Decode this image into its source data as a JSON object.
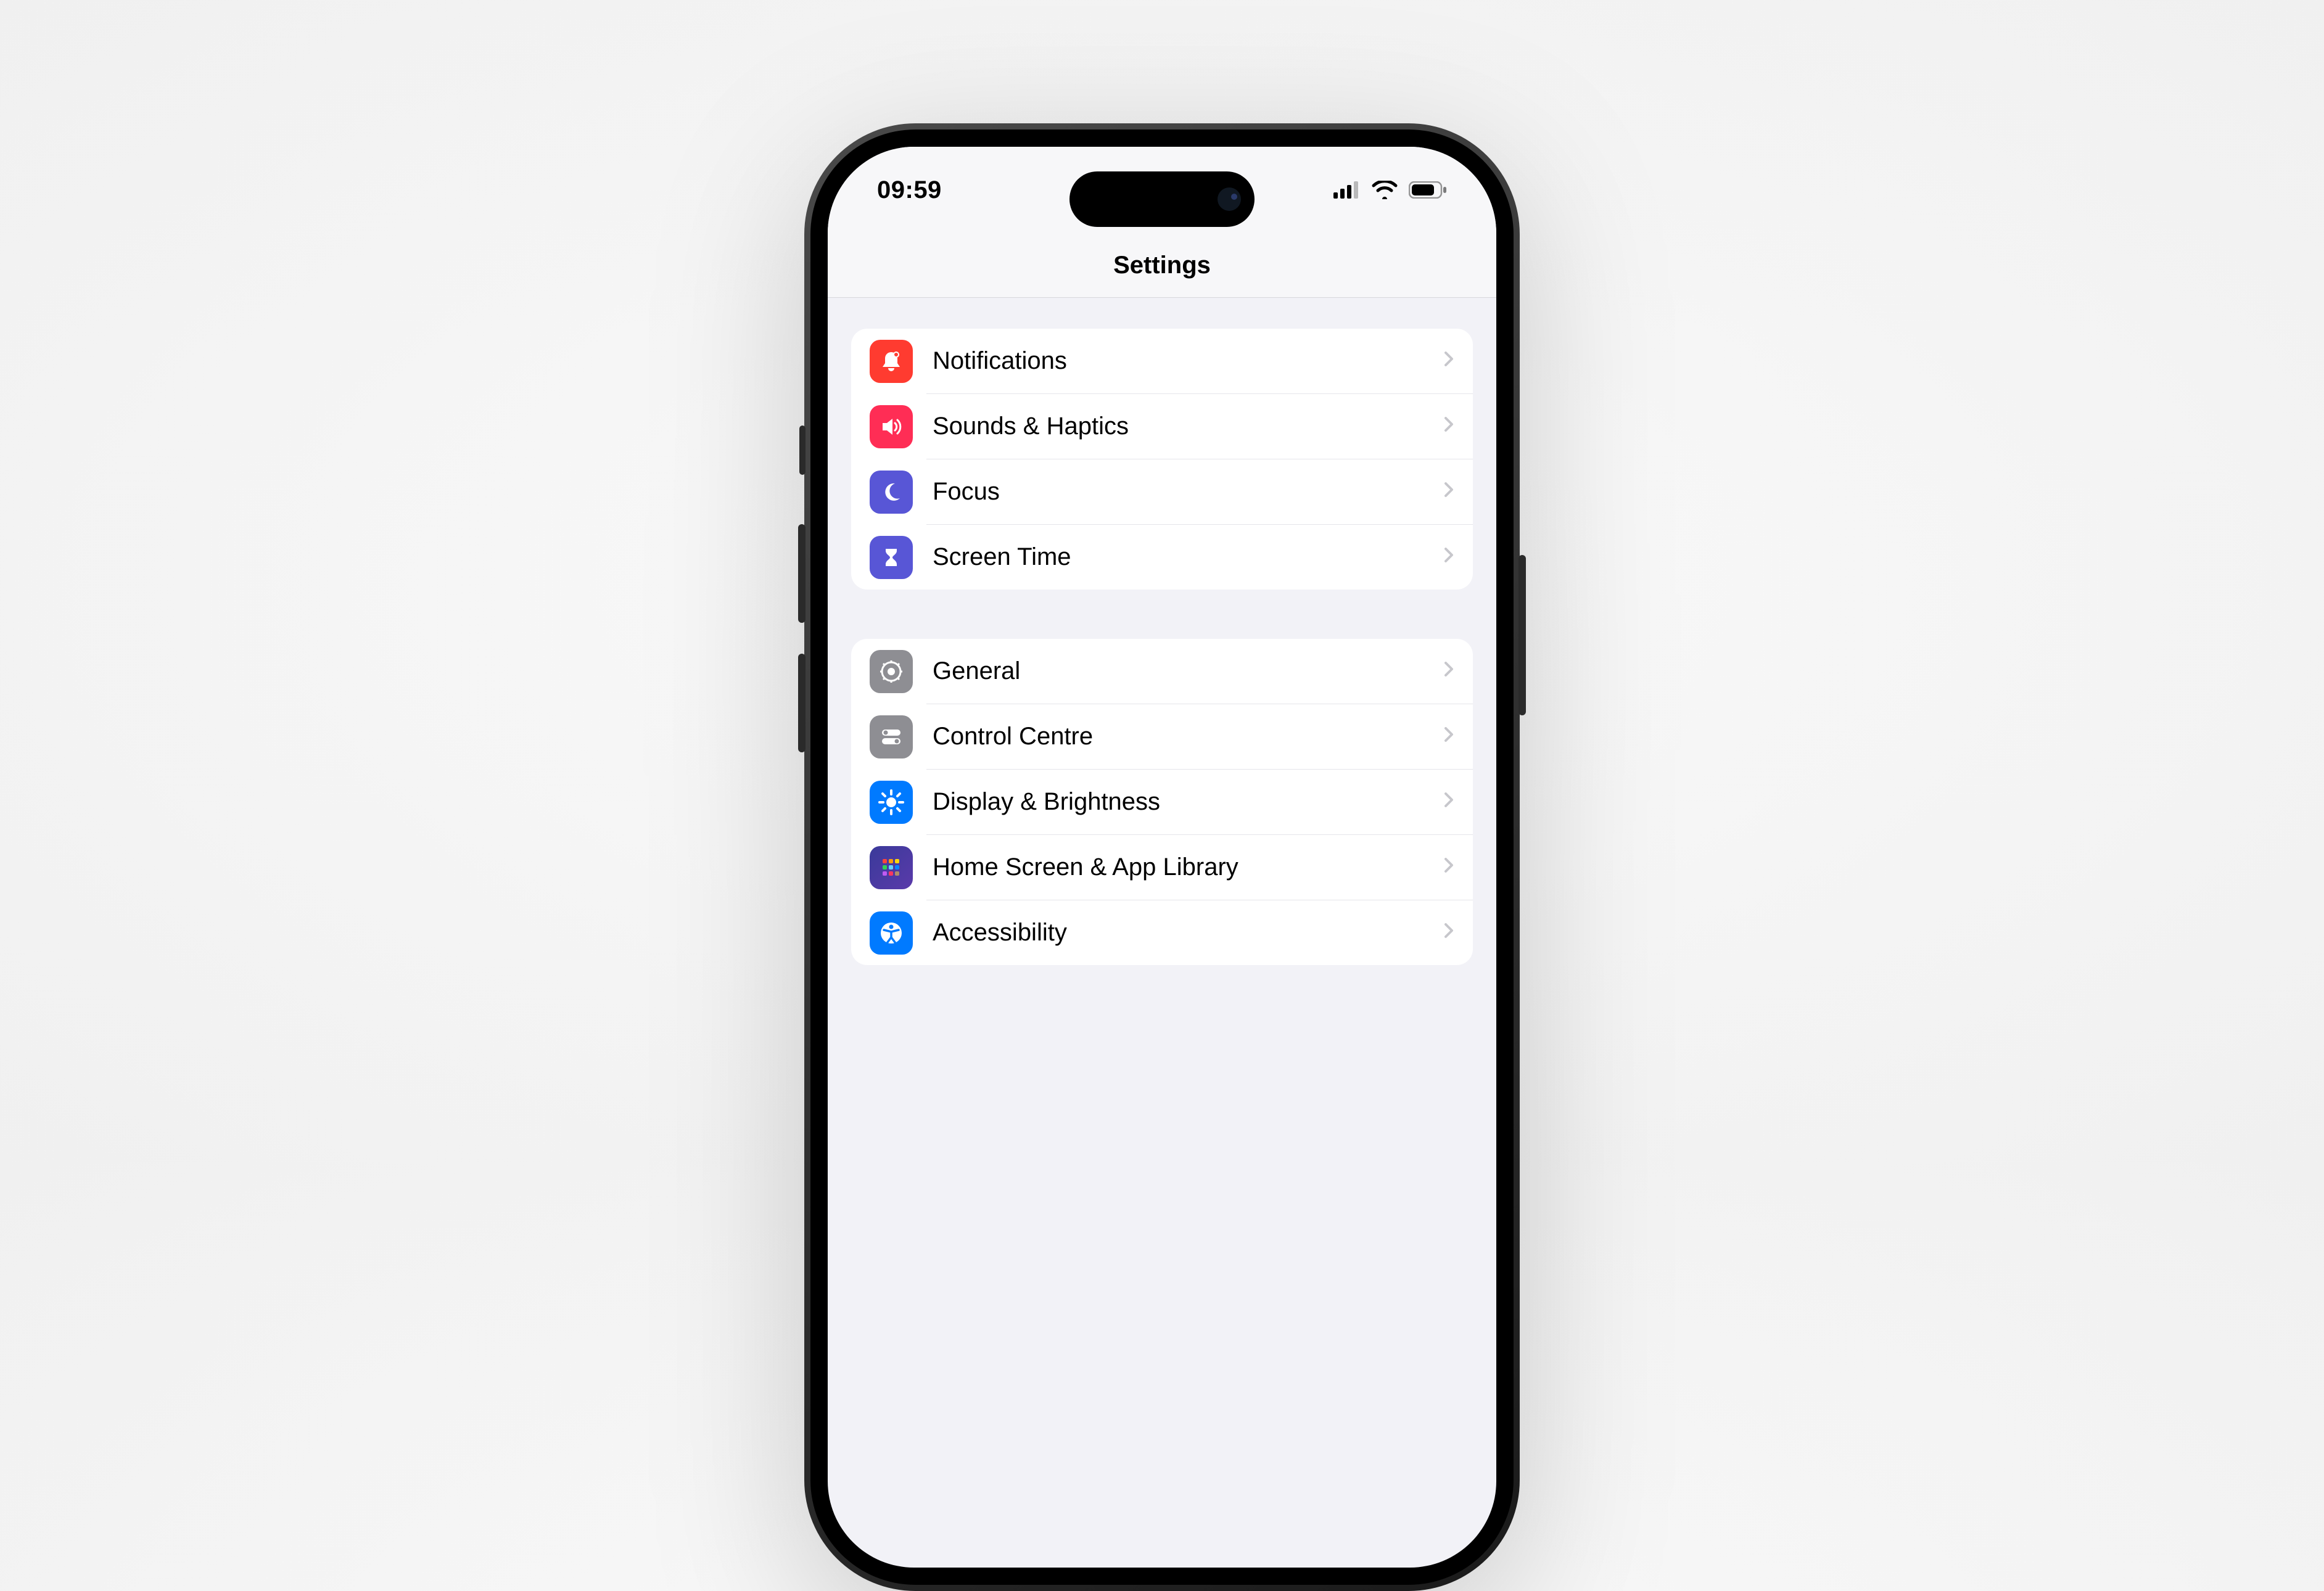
{
  "status": {
    "time": "09:59"
  },
  "header": {
    "title": "Settings"
  },
  "groups": [
    {
      "rows": [
        {
          "id": "notifications",
          "label": "Notifications",
          "icon": "bell-icon",
          "iconClass": "ic-notifications"
        },
        {
          "id": "sounds-haptics",
          "label": "Sounds & Haptics",
          "icon": "speaker-icon",
          "iconClass": "ic-sounds"
        },
        {
          "id": "focus",
          "label": "Focus",
          "icon": "moon-icon",
          "iconClass": "ic-focus"
        },
        {
          "id": "screen-time",
          "label": "Screen Time",
          "icon": "hourglass-icon",
          "iconClass": "ic-screentime"
        }
      ]
    },
    {
      "rows": [
        {
          "id": "general",
          "label": "General",
          "icon": "gear-icon",
          "iconClass": "ic-general"
        },
        {
          "id": "control-centre",
          "label": "Control Centre",
          "icon": "toggles-icon",
          "iconClass": "ic-control"
        },
        {
          "id": "display-brightness",
          "label": "Display & Brightness",
          "icon": "sun-icon",
          "iconClass": "ic-display"
        },
        {
          "id": "home-screen",
          "label": "Home Screen & App Library",
          "icon": "grid-icon",
          "iconClass": "ic-home"
        },
        {
          "id": "accessibility",
          "label": "Accessibility",
          "icon": "accessibility-icon",
          "iconClass": "ic-accessibility"
        }
      ]
    }
  ]
}
